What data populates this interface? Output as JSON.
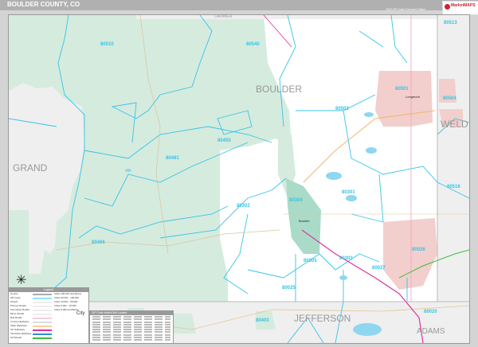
{
  "header": {
    "title": "BOULDER COUNTY, CO",
    "edition": "2020 ZIP Code Premium Edition",
    "logo_text": "MarketMAPS"
  },
  "counties": [
    "LARIMER",
    "BOULDER",
    "GRAND",
    "WELD",
    "JEFFERSON",
    "ADAMS"
  ],
  "zip_codes": [
    "80513",
    "80540",
    "80510",
    "80503",
    "80501",
    "80504",
    "80455",
    "80481",
    "80516",
    "80301",
    "80302",
    "80304",
    "80466",
    "80305",
    "80303",
    "80027",
    "80026",
    "80025",
    "80403",
    "80020"
  ],
  "cities": [
    "Longmont",
    "Boulder"
  ],
  "legend": {
    "title": "Legend",
    "items": [
      "County",
      "ZIP Code",
      "Streets",
      "Primary Roads",
      "Secondary Roads",
      "Minor Roads",
      "Rail Roads",
      "County Highways",
      "State Highways",
      "US Highways",
      "Interstate Highways",
      "Toll Roads"
    ],
    "city_sizes": [
      "Cities 100,001 and Above",
      "Cities 50,001 - 100,000",
      "Cities 10,001 - 50,000",
      "Cities 5,001 - 10,000",
      "Cities 5,000 and Below"
    ],
    "city_sample": "City"
  },
  "index": {
    "title": "ZIP Code Index/Grid Locator"
  },
  "colors": {
    "forest": "#d5ebde",
    "zip": "#35c4e8",
    "urban": "#f2cfcc",
    "neighbor": "#efefef",
    "interstate": "#e0329a",
    "toll": "#3cbf3c"
  }
}
